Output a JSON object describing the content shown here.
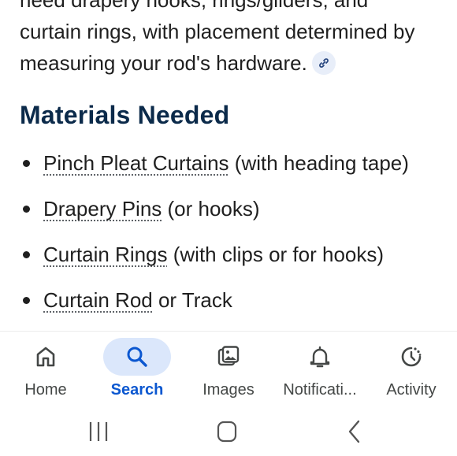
{
  "article": {
    "paragraph_line1": "need drapery hooks, rings/gliders, and",
    "paragraph_line2": "curtain rings, with placement determined by",
    "paragraph_line3": "measuring your rod's hardware.",
    "link_icon": "link-icon",
    "heading": "Materials Needed",
    "items": [
      {
        "term": "Pinch Pleat Curtains",
        "rest": " (with heading tape)"
      },
      {
        "term": "Drapery Pins",
        "rest": " (or hooks)"
      },
      {
        "term": "Curtain Rings",
        "rest": " (with clips or for hooks)"
      },
      {
        "term": "Curtain Rod",
        "rest": " or Track"
      }
    ]
  },
  "bottom_nav": {
    "items": [
      {
        "label": "Home",
        "icon": "home-icon"
      },
      {
        "label": "Search",
        "icon": "search-icon",
        "active": true
      },
      {
        "label": "Images",
        "icon": "images-icon"
      },
      {
        "label": "Notificati...",
        "icon": "bell-icon"
      },
      {
        "label": "Activity",
        "icon": "activity-icon"
      }
    ]
  },
  "colors": {
    "accent": "#0b57d0",
    "active_pill": "#dbe7fb",
    "heading": "#0b2a4a",
    "text": "#1f1f1f"
  }
}
